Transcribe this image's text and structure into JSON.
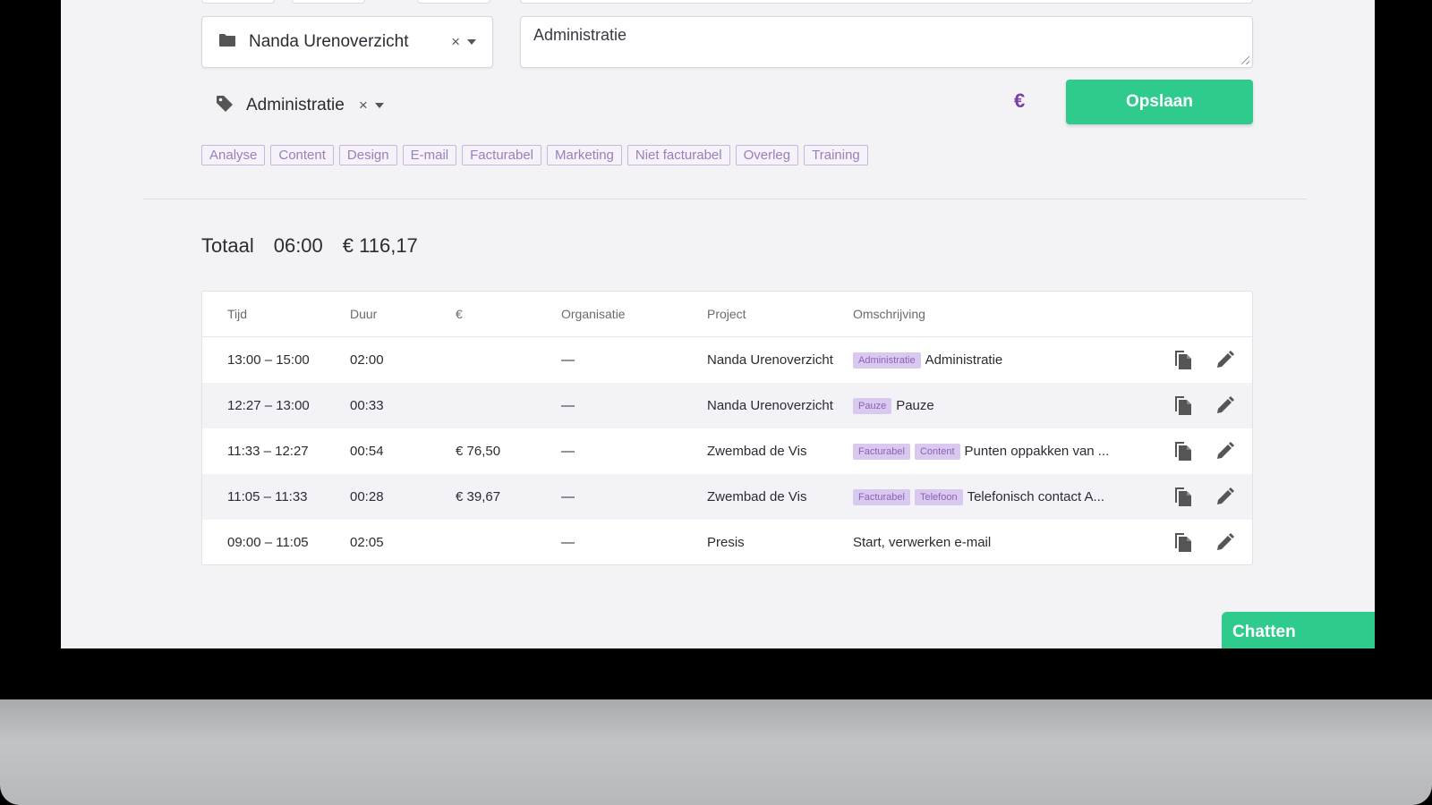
{
  "form": {
    "project_value": "Nanda Urenoverzicht",
    "description_value": "Administratie",
    "tag_value": "Administratie",
    "clear_symbol": "×",
    "euro_symbol": "€",
    "save_label": "Opslaan"
  },
  "quick_tags": [
    "Analyse",
    "Content",
    "Design",
    "E-mail",
    "Facturabel",
    "Marketing",
    "Niet facturabel",
    "Overleg",
    "Training"
  ],
  "totals": {
    "label": "Totaal",
    "duration": "06:00",
    "amount": "€ 116,17"
  },
  "table": {
    "headers": {
      "time": "Tijd",
      "duration": "Duur",
      "amount": "€",
      "organisation": "Organisatie",
      "project": "Project",
      "description": "Omschrijving"
    },
    "rows": [
      {
        "time": "13:00 – 15:00",
        "duration": "02:00",
        "amount": "",
        "organisation": "—",
        "project": "Nanda Urenoverzicht",
        "tags": [
          "Administratie"
        ],
        "description": "Administratie"
      },
      {
        "time": "12:27 – 13:00",
        "duration": "00:33",
        "amount": "",
        "organisation": "—",
        "project": "Nanda Urenoverzicht",
        "tags": [
          "Pauze"
        ],
        "description": "Pauze"
      },
      {
        "time": "11:33 – 12:27",
        "duration": "00:54",
        "amount": "€ 76,50",
        "organisation": "—",
        "project": "Zwembad de Vis",
        "tags": [
          "Facturabel",
          "Content"
        ],
        "description": "Punten oppakken van ..."
      },
      {
        "time": "11:05 – 11:33",
        "duration": "00:28",
        "amount": "€ 39,67",
        "organisation": "—",
        "project": "Zwembad de Vis",
        "tags": [
          "Facturabel",
          "Telefoon"
        ],
        "description": "Telefonisch contact A..."
      },
      {
        "time": "09:00 – 11:05",
        "duration": "02:05",
        "amount": "",
        "organisation": "—",
        "project": "Presis",
        "tags": [],
        "description": "Start, verwerken e-mail"
      }
    ]
  },
  "chat": {
    "label": "Chatten"
  },
  "colors": {
    "accent_green": "#2fcb8d",
    "accent_purple": "#7a3fa8",
    "tag_purple_bg": "#d9c9ee"
  },
  "icons": {
    "project": "folder-icon",
    "tag": "tag-icon",
    "copy": "copy-icon",
    "edit": "pencil-icon",
    "chat_toggle": "chevron-up-icon"
  }
}
